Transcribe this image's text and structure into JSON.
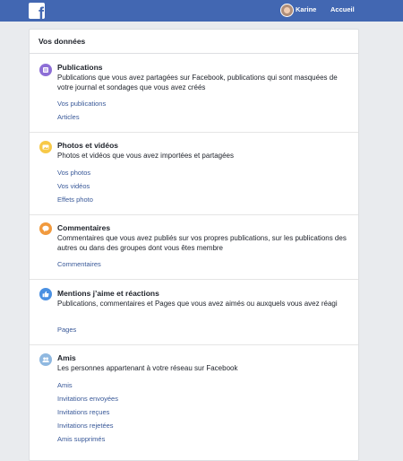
{
  "topbar": {
    "logo": "f",
    "user_name": "Karine",
    "home_label": "Accueil",
    "brand_color": "#4267b2"
  },
  "panel": {
    "title": "Vos données"
  },
  "sections": [
    {
      "icon": "publications-icon",
      "icon_color": "#8d6ed6",
      "title": "Publications",
      "description": "Publications que vous avez partagées sur Facebook, publications qui sont masquées de votre journal et sondages que vous avez créés",
      "links": [
        "Vos publications",
        "Articles"
      ]
    },
    {
      "icon": "photos-videos-icon",
      "icon_color": "#f7c948",
      "title": "Photos et vidéos",
      "description": "Photos et vidéos que vous avez importées et partagées",
      "links": [
        "Vos photos",
        "Vos vidéos",
        "Effets photo"
      ]
    },
    {
      "icon": "comments-icon",
      "icon_color": "#f19a3e",
      "title": "Commentaires",
      "description": "Commentaires que vous avez publiés sur vos propres publications, sur les publications des autres ou dans des groupes dont vous êtes membre",
      "links": [
        "Commentaires"
      ]
    },
    {
      "icon": "like-icon",
      "icon_color": "#4a90e2",
      "title": "Mentions j’aime et réactions",
      "description": "Publications, commentaires et Pages que vous avez aimés ou auxquels vous avez réagi",
      "links": [
        "Pages"
      ]
    },
    {
      "icon": "friends-icon",
      "icon_color": "#8fb8e0",
      "title": "Amis",
      "description": "Les personnes appartenant à votre réseau sur Facebook",
      "links": [
        "Amis",
        "Invitations envoyées",
        "Invitations reçues",
        "Invitations rejetées",
        "Amis supprimés"
      ]
    }
  ]
}
